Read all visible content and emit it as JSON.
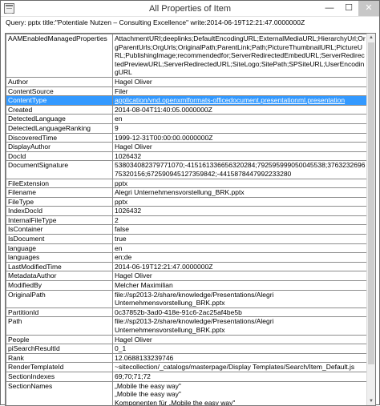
{
  "window": {
    "title": "All Properties of Item",
    "minimize": "—",
    "maximize": "☐",
    "close": "✕"
  },
  "query": "Query: pptx title:\"Potentiale Nutzen – Consulting Excellence\" write:2014-06-19T12:21:47.0000000Z",
  "selected_row": 3,
  "rows": [
    {
      "name": "AAMEnabledManagedProperties",
      "value": "AttachmentURI;deeplinks;DefaultEncodingURL;ExternalMediaURL;HierarchyUrl;OrgParentUrls;OrgUrls;OriginalPath;ParentLink;Path;PictureThumbnailURL;PictureURL;PublishingImage;recommendedfor;ServerRedirectedEmbedURL;ServerRedirectedPreviewURL;ServerRedirectedURL;SiteLogo;SitePath;SPSiteURL;UserEncodingURL"
    },
    {
      "name": "Author",
      "value": "Hagel Oliver"
    },
    {
      "name": "ContentSource",
      "value": "Filer"
    },
    {
      "name": "ContentType",
      "value": "application/vnd.openxmlformats-officedocument.presentationml.presentation"
    },
    {
      "name": "Created",
      "value": "2014-08-04T11:40:05.0000000Z"
    },
    {
      "name": "DetectedLanguage",
      "value": "en"
    },
    {
      "name": "DetectedLanguageRanking",
      "value": "9"
    },
    {
      "name": "DiscoveredTime",
      "value": "1999-12-31T00:00:00.0000000Z"
    },
    {
      "name": "DisplayAuthor",
      "value": "Hagel Oliver"
    },
    {
      "name": "DocId",
      "value": "1026432"
    },
    {
      "name": "DocumentSignature",
      "value": "538034082379771070;-415161336656320284;792595999050045538;376323269675320156;672590945127359842;-4415878447992233280"
    },
    {
      "name": "FileExtension",
      "value": "pptx"
    },
    {
      "name": "Filename",
      "value": "Alegri Unternehmensvorstellung_BRK.pptx"
    },
    {
      "name": "FileType",
      "value": "pptx"
    },
    {
      "name": "IndexDocId",
      "value": "1026432"
    },
    {
      "name": "InternalFileType",
      "value": "2"
    },
    {
      "name": "IsContainer",
      "value": "false"
    },
    {
      "name": "IsDocument",
      "value": "true"
    },
    {
      "name": "language",
      "value": "en"
    },
    {
      "name": "languages",
      "value": "en;de"
    },
    {
      "name": "LastModifiedTime",
      "value": "2014-06-19T12:21:47.0000000Z"
    },
    {
      "name": "MetadataAuthor",
      "value": "Hagel Oliver"
    },
    {
      "name": "ModifiedBy",
      "value": "Melcher Maximilian"
    },
    {
      "name": "OriginalPath",
      "value": "file://sp2013-2/share/knowledge/Presentations/Alegri Unternehmensvorstellung_BRK.pptx"
    },
    {
      "name": "PartitionId",
      "value": "0c37852b-3ad0-418e-91c6-2ac25af4be5b"
    },
    {
      "name": "Path",
      "value": "file://sp2013-2/share/knowledge/Presentations/Alegri Unternehmensvorstellung_BRK.pptx"
    },
    {
      "name": "People",
      "value": "Hagel Oliver"
    },
    {
      "name": "piSearchResultId",
      "value": "0_1"
    },
    {
      "name": "Rank",
      "value": "12.0688133239746"
    },
    {
      "name": "RenderTemplateId",
      "value": "~sitecollection/_catalogs/masterpage/Display Templates/Search/Item_Default.js"
    },
    {
      "name": "SectionIndexes",
      "value": "69;70;71;72"
    },
    {
      "name": "SectionNames",
      "value": "„Mobile the easy way\"\n„Mobile the easy way\"\nKomponenten  für „Mobile the easy way\"\n;„Mobile the easy way\" Kunden-Extranet"
    }
  ]
}
